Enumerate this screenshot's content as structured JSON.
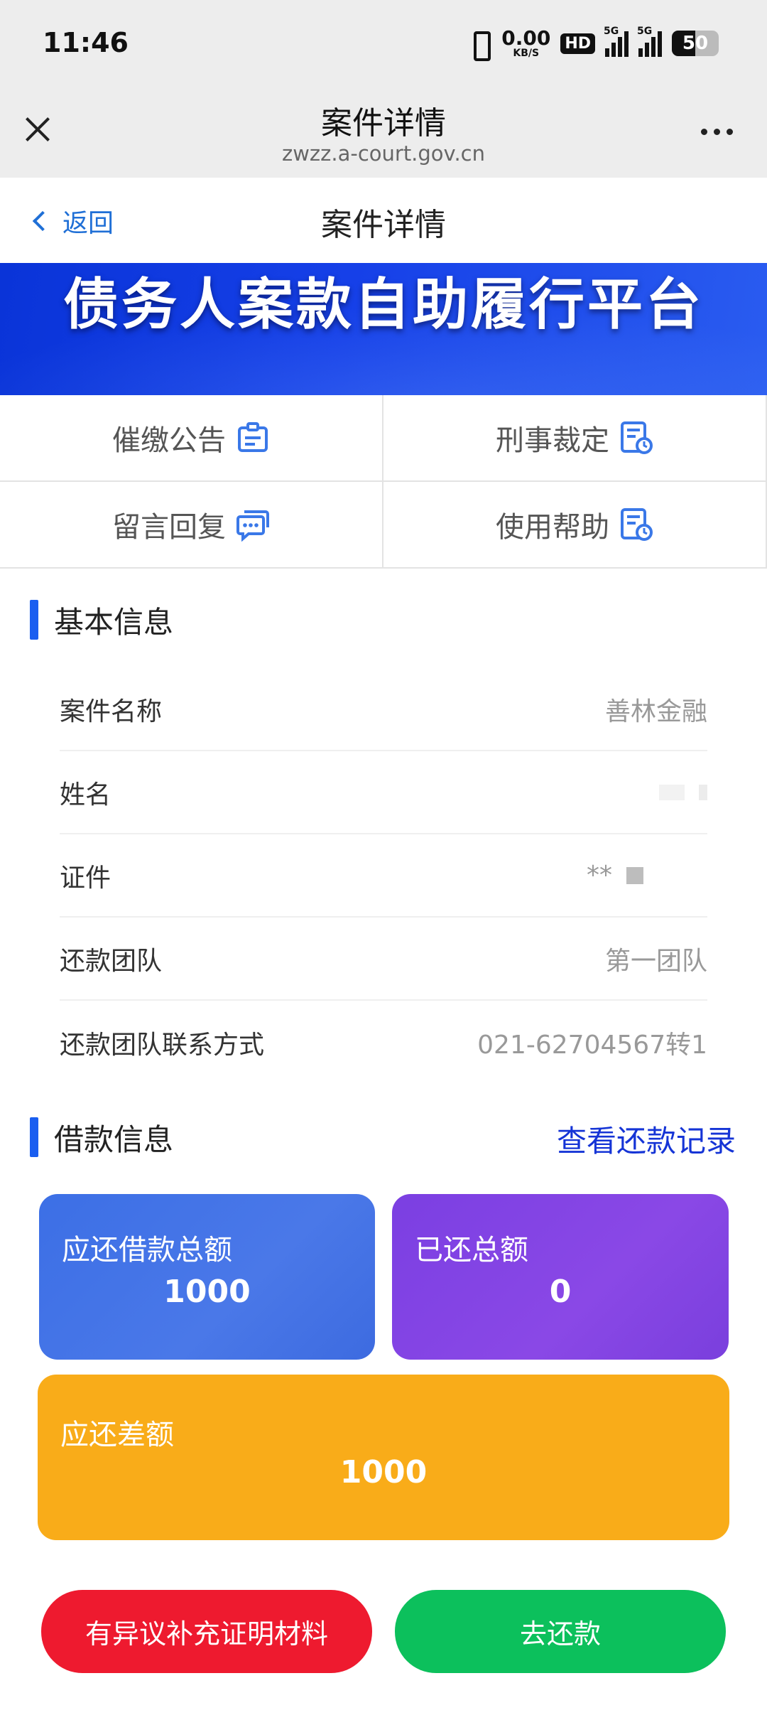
{
  "status_bar": {
    "time": "11:46",
    "net_speed_value": "0.00",
    "net_speed_unit": "KB/S",
    "hd_label": "HD",
    "signal_label_1": "5G",
    "signal_label_2": "5G",
    "battery": "50"
  },
  "browser": {
    "title": "案件详情",
    "url": "zwzz.a-court.gov.cn"
  },
  "page_nav": {
    "back_label": "返回",
    "title": "案件详情"
  },
  "banner": {
    "text": "债务人案款自助履行平台",
    "colors": {
      "primary": "#0a34d8"
    }
  },
  "quick_grid": [
    {
      "label": "催缴公告",
      "icon": "notice-icon"
    },
    {
      "label": "刑事裁定",
      "icon": "document-clock-icon"
    },
    {
      "label": "留言回复",
      "icon": "chat-icon"
    },
    {
      "label": "使用帮助",
      "icon": "document-clock-icon"
    }
  ],
  "basic_info": {
    "section_title": "基本信息",
    "rows": [
      {
        "label": "案件名称",
        "value": "善林金融"
      },
      {
        "label": "姓名",
        "value": ""
      },
      {
        "label": "证件",
        "value": "**"
      },
      {
        "label": "还款团队",
        "value": "第一团队"
      },
      {
        "label": "还款团队联系方式",
        "value": "021-62704567转1"
      }
    ]
  },
  "loan_info": {
    "section_title": "借款信息",
    "records_link": "查看还款记录",
    "cards": {
      "total_due": {
        "title": "应还借款总额",
        "value": "1000"
      },
      "total_paid": {
        "title": "已还总额",
        "value": "0"
      },
      "remaining": {
        "title": "应还差额",
        "value": "1000"
      }
    }
  },
  "actions": {
    "dispute_label": "有异议补充证明材料",
    "pay_label": "去还款"
  },
  "colors": {
    "accent": "#1a5ef0",
    "link": "#1534d6",
    "card_blue": "#4a78e8",
    "card_purple": "#8a48e6",
    "card_orange": "#f9ac19",
    "button_red": "#ee1a2f",
    "button_green": "#0cc05c"
  }
}
